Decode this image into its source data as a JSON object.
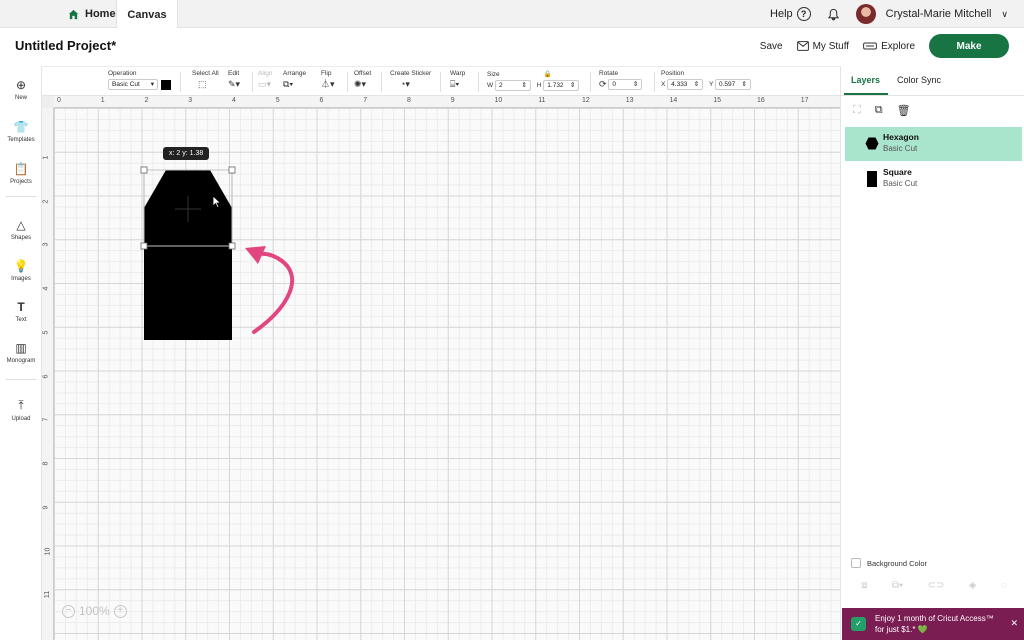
{
  "topbar": {
    "home_label": "Home",
    "canvas_label": "Canvas",
    "help_label": "Help",
    "user_name": "Crystal-Marie Mitchell"
  },
  "header": {
    "project_title": "Untitled Project*",
    "save_label": "Save",
    "mystuff_label": "My Stuff",
    "explore_label": "Explore",
    "make_label": "Make",
    "make_color": "#187443"
  },
  "toolbar": {
    "operation_label": "Operation",
    "operation_value": "Basic Cut",
    "selectall_label": "Select All",
    "edit_label": "Edit",
    "align_label": "Align",
    "arrange_label": "Arrange",
    "flip_label": "Flip",
    "offset_label": "Offset",
    "sticker_label": "Create Sticker",
    "warp_label": "Warp",
    "size_label": "Size",
    "w_label": "W",
    "w_value": "2",
    "h_label": "H",
    "h_value": "1.732",
    "rotate_label": "Rotate",
    "rotate_value": "0",
    "position_label": "Position",
    "x_label": "X",
    "x_value": "4.333",
    "y_label": "Y",
    "y_value": "0.597"
  },
  "sidebar": {
    "items": [
      {
        "label": "New",
        "icon": "plus-circle-icon"
      },
      {
        "label": "Templates",
        "icon": "shirt-icon"
      },
      {
        "label": "Projects",
        "icon": "clipboard-icon"
      },
      {
        "label": "Shapes",
        "icon": "shapes-icon"
      },
      {
        "label": "Images",
        "icon": "lightbulb-icon"
      },
      {
        "label": "Text",
        "icon": "text-icon"
      },
      {
        "label": "Monogram",
        "icon": "monogram-icon"
      },
      {
        "label": "Upload",
        "icon": "upload-icon"
      }
    ]
  },
  "canvas": {
    "ruler_h": [
      "0",
      "1",
      "2",
      "3",
      "4",
      "5",
      "6",
      "7",
      "8",
      "9",
      "10",
      "11",
      "12",
      "13",
      "14",
      "15",
      "16",
      "17"
    ],
    "ruler_v": [
      "1",
      "2",
      "3",
      "4",
      "5",
      "6",
      "7",
      "8",
      "9",
      "10",
      "11"
    ],
    "coord_tooltip": "x: 2 y: 1.38",
    "zoom_value": "100%",
    "arrow_color": "#e2457f"
  },
  "panel": {
    "tab_layers": "Layers",
    "tab_colorsync": "Color Sync",
    "layers": [
      {
        "name": "Hexagon",
        "operation": "Basic Cut",
        "selected": true
      },
      {
        "name": "Square",
        "operation": "Basic Cut",
        "selected": false
      }
    ],
    "background_color_label": "Background Color",
    "selected_color": "#a9e4cc"
  },
  "promo": {
    "text": "Enjoy 1 month of Cricut Access™ for just $1.* 💚",
    "color": "#7a1d52"
  }
}
